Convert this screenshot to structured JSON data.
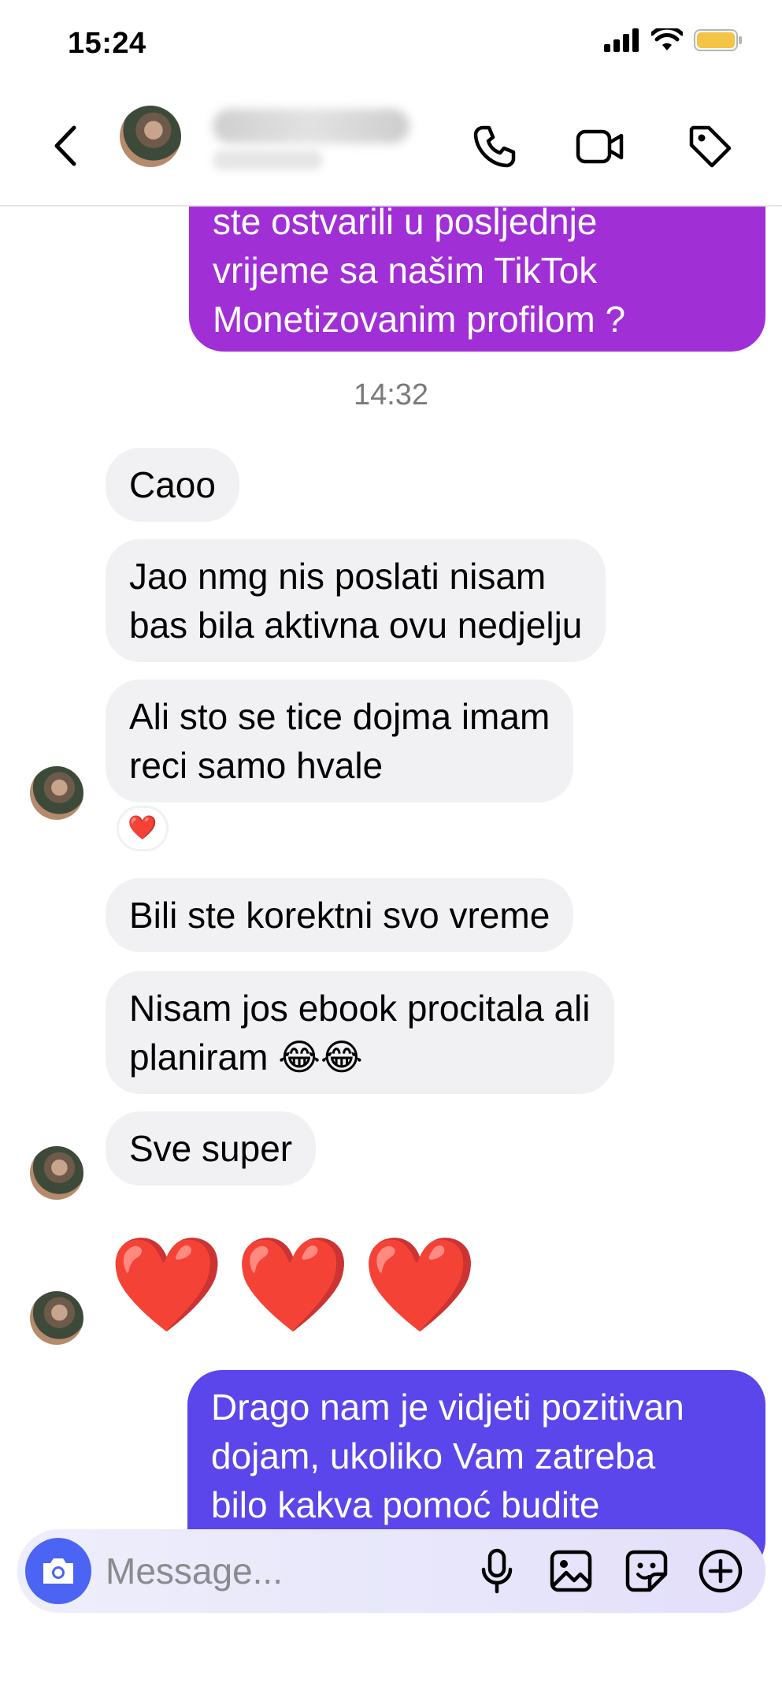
{
  "status_bar": {
    "time": "15:24"
  },
  "chat": {
    "first_outgoing_lines": [
      "ste ostvarili u posljednje",
      "vrijeme sa našim TikTok",
      "Monetizovanim profilom ?"
    ],
    "timestamp": "14:32",
    "incoming": [
      {
        "lines": [
          "Caoo"
        ]
      },
      {
        "lines": [
          "Jao nmg nis poslati nisam",
          "bas bila aktivna ovu nedjelju"
        ]
      },
      {
        "lines": [
          "Ali sto se tice dojma imam",
          "reci samo hvale"
        ]
      },
      {
        "lines": [
          "Bili ste korektni svo vreme"
        ]
      },
      {
        "lines": [
          "Nisam jos ebook procitala ali",
          "planiram 😂😂"
        ]
      },
      {
        "lines": [
          "Sve super"
        ]
      }
    ],
    "reaction_emoji": "❤️",
    "hearts": "❤️❤️❤️",
    "last_outgoing_lines": [
      "Drago nam je vidjeti pozitivan",
      "dojam, ukoliko Vam zatreba",
      "bilo kakva pomoć budite"
    ]
  },
  "composer": {
    "placeholder": "Message..."
  },
  "colors": {
    "outgoing_purple": "#a12fd6",
    "outgoing_violet": "#5a46ea",
    "incoming_bubble": "#f1f1f3",
    "camera_button": "#4b64f4"
  },
  "icons": [
    "back-chevron-icon",
    "phone-icon",
    "video-call-icon",
    "tag-icon",
    "camera-icon",
    "microphone-icon",
    "image-icon",
    "sticker-icon",
    "plus-icon"
  ]
}
